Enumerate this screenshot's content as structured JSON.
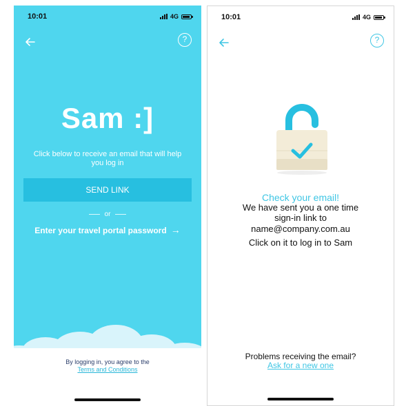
{
  "colors": {
    "brand_cyan": "#4fd6ee",
    "button_cyan": "#27bfe0",
    "accent_cyan": "#3fc6e4",
    "lock_body": "#f3ecd8"
  },
  "status_bar": {
    "time": "10:01",
    "network": "4G"
  },
  "icons": {
    "back": "back-arrow-icon",
    "help": "help-icon",
    "lock": "padlock-check-icon"
  },
  "login_screen": {
    "help_glyph": "?",
    "brand": "Sam :]",
    "instruction": "Click below to receive an email that will help you log in",
    "send_link_label": "SEND LINK",
    "or_label": "or",
    "portal_link_label": "Enter your travel portal password",
    "portal_arrow": "→",
    "terms_prefix": "By logging in, you agree to the",
    "terms_link": "Terms and Conditions"
  },
  "confirm_screen": {
    "help_glyph": "?",
    "title": "Check your email!",
    "line_1": "We have sent you a one time",
    "line_2": "sign-in link to",
    "email": "name@company.com.au",
    "line_4": "Click on it to log in to Sam",
    "problems_label": "Problems receiving the email?",
    "ask_link": "Ask for a new one"
  }
}
